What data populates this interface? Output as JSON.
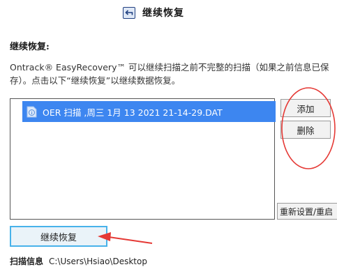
{
  "header": {
    "title": "继续恢复",
    "icon": "back-arrow-icon"
  },
  "section": {
    "heading": "继续恢复:",
    "description_line1": "Ontrack® EasyRecovery™ 可以继续扫描之前不完整的扫描（如果之前信息已保",
    "description_line2": "存）。点击以下“继续恢复”以继续数据恢复。"
  },
  "file_list": {
    "items": [
      {
        "label": "OER 扫描 ,周三 1月 13 2021 21-14-29.DAT",
        "icon": "file-info-icon",
        "selected": true
      }
    ]
  },
  "buttons": {
    "add": "添加",
    "delete": "删除",
    "reset": "重新设置/重启",
    "continue": "继续恢复"
  },
  "scan_info": {
    "label": "扫描信息",
    "value": "C:\\Users\\Hsiao\\Desktop"
  },
  "colors": {
    "selection": "#3d86f0",
    "annotation": "#e53935",
    "continue_border": "#48b2ea"
  }
}
